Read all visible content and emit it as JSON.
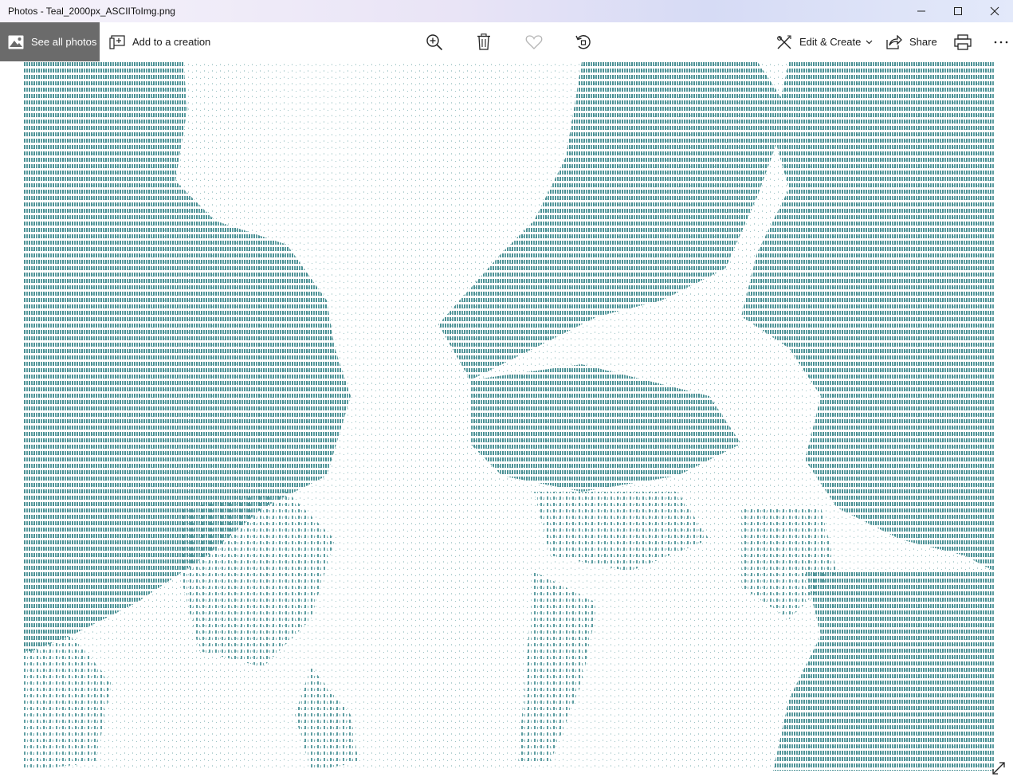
{
  "window": {
    "title": "Photos - Teal_2000px_ASCIIToImg.png"
  },
  "toolbar": {
    "see_all_label": "See all photos",
    "add_creation_label": "Add to a creation",
    "edit_create_label": "Edit & Create",
    "share_label": "Share"
  },
  "image": {
    "ink_color": "#4a8f93"
  },
  "icons": {
    "photos": "image-icon",
    "creation": "add-creation-icon",
    "zoom": "zoom-in-icon",
    "delete": "trash-icon",
    "favorite": "heart-icon",
    "rotate": "rotate-icon",
    "edit": "edit-create-icon",
    "share": "share-icon",
    "print": "print-icon",
    "more": "more-icon",
    "expand": "fullscreen-icon"
  }
}
